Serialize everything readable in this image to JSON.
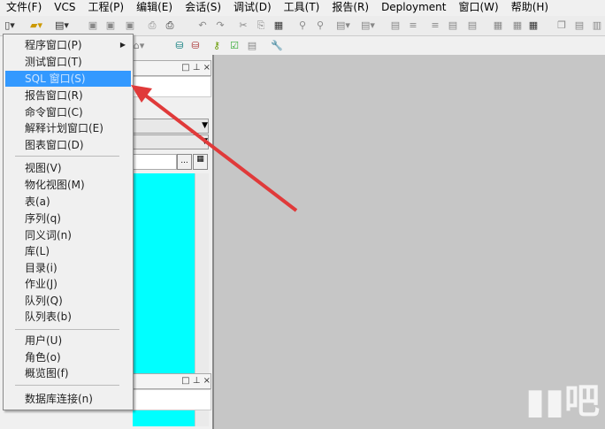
{
  "menubar": [
    "文件(F)",
    "VCS",
    "工程(P)",
    "编辑(E)",
    "会话(S)",
    "调试(D)",
    "工具(T)",
    "报告(R)",
    "Deployment",
    "窗口(W)",
    "帮助(H)"
  ],
  "menu": {
    "items": [
      {
        "label": "程序窗口(P)",
        "submenu": true
      },
      {
        "label": "测试窗口(T)"
      },
      {
        "label": "SQL 窗口(S)",
        "highlighted": true
      },
      {
        "label": "报告窗口(R)"
      },
      {
        "label": "命令窗口(C)"
      },
      {
        "label": "解释计划窗口(E)"
      },
      {
        "label": "图表窗口(D)"
      },
      {
        "label": "视图(V)"
      },
      {
        "label": "物化视图(M)"
      },
      {
        "label": "表(a)"
      },
      {
        "label": "序列(q)"
      },
      {
        "label": "同义词(n)"
      },
      {
        "label": "库(L)"
      },
      {
        "label": "目录(i)"
      },
      {
        "label": "作业(J)"
      },
      {
        "label": "队列(Q)"
      },
      {
        "label": "队列表(b)"
      },
      {
        "label": "用户(U)"
      },
      {
        "label": "角色(o)"
      },
      {
        "label": "概览图(f)"
      },
      {
        "label": "数据库连接(n)"
      }
    ]
  },
  "pane": {
    "buttons": "□ ⊥ ×",
    "browse": "..."
  },
  "watermark": "下载吧",
  "colors": {
    "highlight": "#3399ff",
    "object_list": "#00ffff",
    "arrow": "#e03a3a"
  }
}
